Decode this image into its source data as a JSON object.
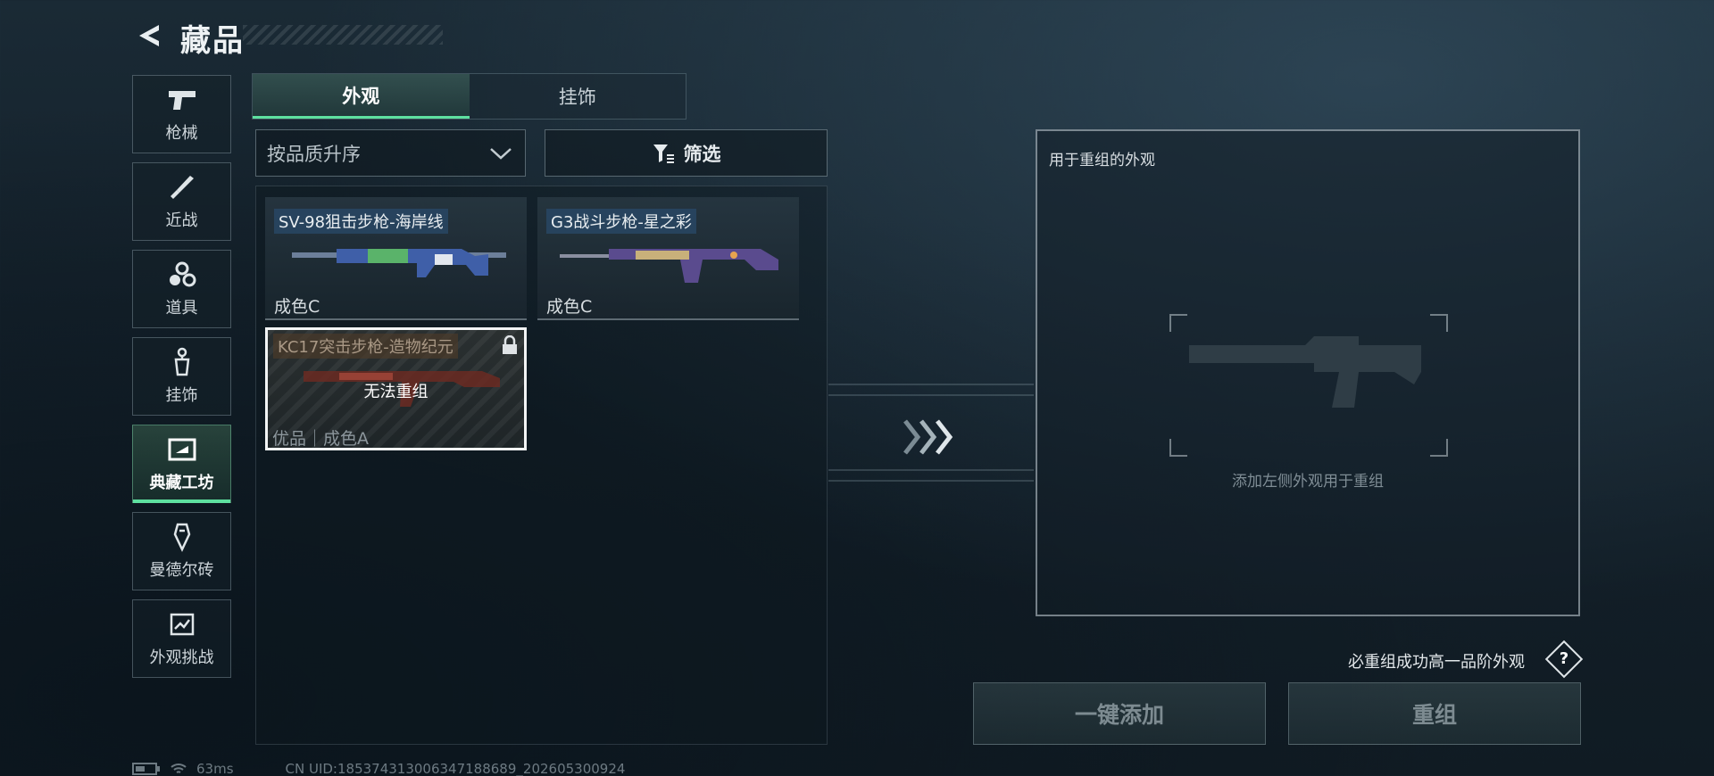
{
  "header": {
    "title": "藏品"
  },
  "categories": [
    {
      "label": "枪械",
      "icon": "pistol-icon",
      "active": false
    },
    {
      "label": "近战",
      "icon": "knife-icon",
      "active": false
    },
    {
      "label": "道具",
      "icon": "grenades-icon",
      "active": false
    },
    {
      "label": "挂饰",
      "icon": "charm-icon",
      "active": false
    },
    {
      "label": "典藏工坊",
      "icon": "workshop-icon",
      "active": true
    },
    {
      "label": "曼德尔砖",
      "icon": "mandel-brick-icon",
      "active": false
    },
    {
      "label": "外观挑战",
      "icon": "challenge-icon",
      "active": false
    }
  ],
  "tabs": [
    {
      "label": "外观",
      "active": true
    },
    {
      "label": "挂饰",
      "active": false
    }
  ],
  "toolbar": {
    "sort_label": "按品质升序",
    "filter_label": "筛选"
  },
  "items": [
    {
      "name": "SV-98狙击步枪-海岸线",
      "grade": "成色C",
      "locked": false
    },
    {
      "name": "G3战斗步枪-星之彩",
      "grade": "成色C",
      "locked": false
    },
    {
      "name": "KC17突击步枪-造物纪元",
      "grade": "优品｜成色A",
      "locked": true,
      "overlay": "无法重组"
    }
  ],
  "reforge": {
    "header": "用于重组的外观",
    "hint": "添加左侧外观用于重组",
    "guarantee": "必重组成功高一品阶外观",
    "help": "?",
    "add_all_label": "一键添加",
    "reforge_label": "重组"
  },
  "status": {
    "ping": "63ms",
    "uid": "CN UID:18537431300634718​8689_202605300924"
  },
  "colors": {
    "accent": "#5ee0a0",
    "locked_border": "#f2f4f5"
  }
}
